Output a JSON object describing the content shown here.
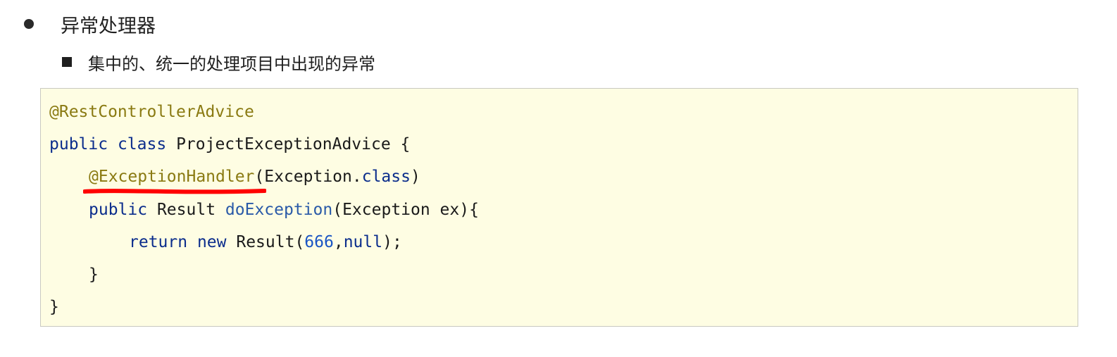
{
  "bullets": {
    "level1_text": "异常处理器",
    "level2_text": "集中的、统一的处理项目中出现的异常"
  },
  "code": {
    "line1": {
      "annotation": "@RestControllerAdvice"
    },
    "line2": {
      "kw1": "public",
      "kw2": "class",
      "rest": "ProjectExceptionAdvice {"
    },
    "line3": {
      "annotation": "@ExceptionHandler",
      "open": "(Exception.",
      "kw": "class",
      "close": ")"
    },
    "line4": {
      "kw": "public",
      "type": "Result",
      "method": "doException",
      "params": "(Exception ex){"
    },
    "line5": {
      "kw1": "return",
      "kw2": "new",
      "call": "Result(",
      "num": "666",
      "comma": ",",
      "kw3": "null",
      "end": ");"
    },
    "line6": {
      "text": "}"
    },
    "line7": {
      "text": "}"
    }
  },
  "colors": {
    "annotation": "#8a7a12",
    "keyword": "#0b2d8c",
    "number": "#1a55c4",
    "code_background": "#fefde3",
    "highlight_underline": "#ff0000"
  }
}
